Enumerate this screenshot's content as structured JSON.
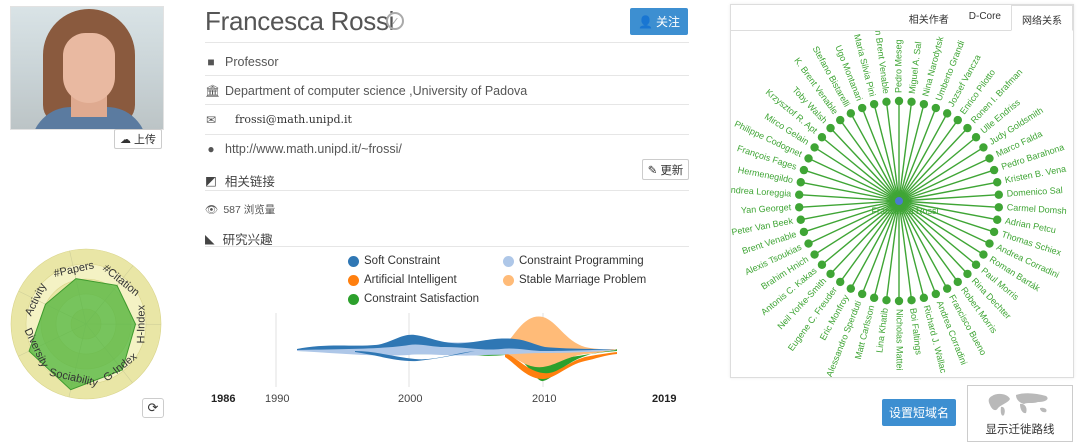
{
  "profile": {
    "name": "Francesca Rossi",
    "upload_label": "上传",
    "follow_label": "关注",
    "position": "Professor",
    "affiliation": "Department of computer science ,University of Padova",
    "email": "frossi@math.unipd.it",
    "homepage": "http://www.math.unipd.it/~frossi/",
    "update_label": "更新",
    "links_title": "相关链接",
    "views": "587 浏览量",
    "interests_title": "研究兴趣"
  },
  "radar": {
    "axes": [
      "#Papers",
      "#Citation",
      "H-Index",
      "G-Index",
      "Sociability",
      "Diversity",
      "Activity"
    ],
    "values": [
      0.62,
      0.66,
      0.66,
      0.78,
      0.9,
      0.84,
      0.6
    ],
    "colors": {
      "fill": "#57b844",
      "ring_light": "#f4f2c4",
      "ring_dark": "#e9e6a6"
    }
  },
  "interests": {
    "legend": [
      {
        "label": "Soft Constraint",
        "color": "#2f77b4"
      },
      {
        "label": "Constraint Programming",
        "color": "#aec7e8"
      },
      {
        "label": "Artificial Intelligent",
        "color": "#ff7f0e"
      },
      {
        "label": "Stable Marriage Problem",
        "color": "#ffbb78"
      },
      {
        "label": "Constraint Satisfaction",
        "color": "#2ca02c"
      }
    ],
    "start_year": "1986",
    "end_year": "2019",
    "ticks": [
      "1990",
      "2000",
      "2010"
    ]
  },
  "network": {
    "tabs": [
      "相关作者",
      "D-Core",
      "网络关系"
    ],
    "active_tab": "网络关系",
    "center": "Francesca Rossi",
    "color": "#3fa535",
    "center_color": "#4a7ad1",
    "names": [
      "Pedro Meseg",
      "Miguel A. Sal",
      "Nina Narodytsk",
      "Umberto Grandi",
      "Jozsef Vancza",
      "Enrico Pilotto",
      "Ronen I. Brafman",
      "Ulle Endriss",
      "Judy Goldsmith",
      "Marco Falda",
      "Pedro Barahona",
      "Kristen B. Vena",
      "Domenico Sal",
      "Carmel Domsh",
      "Adrian Petcu",
      "Thomas Schiex",
      "Andrea Corradini",
      "Roman Barták",
      "Paul Morris",
      "Rina Dechter",
      "Robert Morris",
      "Francisco Bueno",
      "Andrea Corradini",
      "Richard J. Wallac",
      "Boi Faltings",
      "Nicholas Mattei",
      "Lina Khatib",
      "Matt Carlsson",
      "Alessandro Sperduti",
      "Eric Monfroy",
      "Eugene C. Freuder",
      "Neil Yorke-Smith",
      "Antonis C. Kakas",
      "Brahim Hnich",
      "Alexis Tsoukias",
      "Brent Venable",
      "Peter Van Beek",
      "Yan Georget",
      "Andrea Loreggia",
      "Hermenegildo",
      "François Fages",
      "Philippe Codognet",
      "Mirco Gelain",
      "Krzysztof R. Apt",
      "Toby Walsh",
      "K. Brent Venable",
      "Stefano Bistarelli",
      "Ugo Montanari",
      "Maria Silvia Pini",
      "Kristen Brent Venable"
    ]
  },
  "actions": {
    "short_url_label": "设置短域名",
    "migration_label": "显示迁徙路线"
  }
}
